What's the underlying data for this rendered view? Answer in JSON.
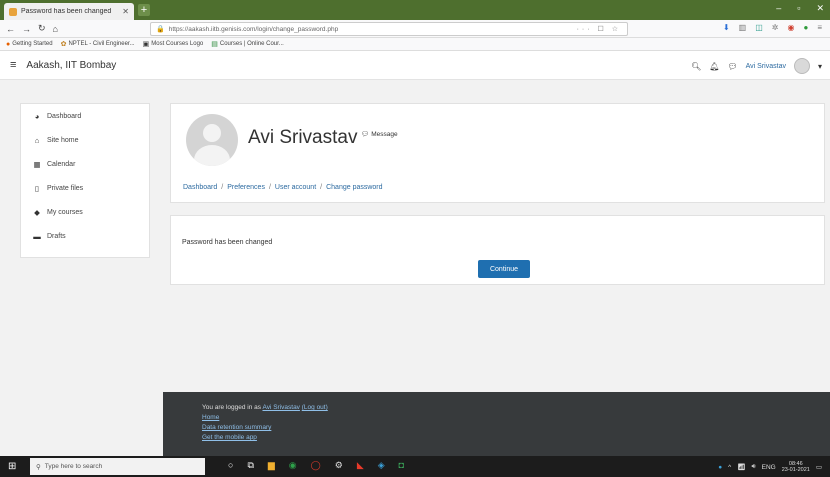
{
  "browser": {
    "tab_title": "Password has been changed",
    "url": "https://aakash.iitb.genisis.com/login/change_password.php",
    "bookmarks": [
      "Getting Started",
      "NPTEL - Civil Engineer...",
      "Most Courses Logo",
      "Courses | Online Cour..."
    ]
  },
  "header": {
    "site_name": "Aakash, IIT Bombay",
    "user_name": "Avi Srivastav"
  },
  "nav": {
    "items": [
      {
        "label": "Dashboard",
        "icon": "dashboard-icon"
      },
      {
        "label": "Site home",
        "icon": "home-icon"
      },
      {
        "label": "Calendar",
        "icon": "calendar-icon"
      },
      {
        "label": "Private files",
        "icon": "file-icon"
      },
      {
        "label": "My courses",
        "icon": "graduation-cap-icon"
      },
      {
        "label": "Drafts",
        "icon": "drafts-icon"
      }
    ]
  },
  "profile": {
    "name": "Avi Srivastav",
    "message_label": "Message"
  },
  "breadcrumb": [
    "Dashboard",
    "Preferences",
    "User account",
    "Change password"
  ],
  "content": {
    "notice": "Password has been changed",
    "continue_label": "Continue"
  },
  "footer": {
    "logged_in_prefix": "You are logged in as",
    "logged_in_user": "Avi Srivastav",
    "logout_label": "(Log out)",
    "home": "Home",
    "data_retention": "Data retention summary",
    "mobile_app": "Get the mobile app"
  },
  "taskbar": {
    "search_placeholder": "Type here to search",
    "lang": "ENG",
    "time": "08:46",
    "date": "23-01-2021"
  }
}
